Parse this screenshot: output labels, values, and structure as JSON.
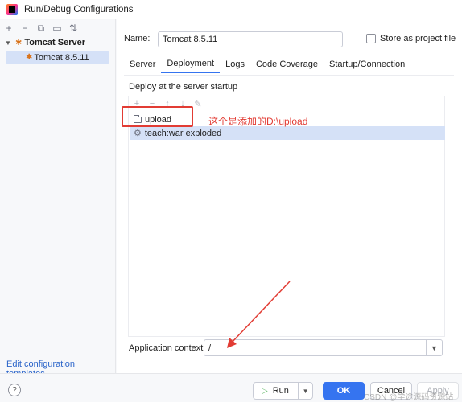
{
  "window": {
    "title": "Run/Debug Configurations"
  },
  "left_panel": {
    "toolbar_icons": [
      "add-icon",
      "remove-icon",
      "copy-icon",
      "folder-icon",
      "sort-icon"
    ],
    "group_label": "Tomcat Server",
    "selected_item": "Tomcat 8.5.11",
    "edit_templates_link": "Edit configuration templates..."
  },
  "config": {
    "name_label": "Name:",
    "name_value": "Tomcat 8.5.11",
    "store_label": "Store as project file",
    "store_checked": false
  },
  "tabs": [
    {
      "label": "Server",
      "active": false
    },
    {
      "label": "Deployment",
      "active": true
    },
    {
      "label": "Logs",
      "active": false
    },
    {
      "label": "Code Coverage",
      "active": false
    },
    {
      "label": "Startup/Connection",
      "active": false
    }
  ],
  "deployment": {
    "section_label": "Deploy at the server startup",
    "toolbar_icons": [
      "add-icon",
      "remove-icon",
      "move-up-icon",
      "move-down-icon",
      "edit-icon"
    ],
    "items": [
      {
        "label": "upload",
        "icon": "folder-icon"
      },
      {
        "label": "teach:war exploded",
        "icon": "artifact-icon",
        "selected": true
      }
    ],
    "annotation": "这个是添加的D:\\upload",
    "annotation_color": "#e23c34"
  },
  "app_context": {
    "label": "Application context:",
    "value": "/"
  },
  "buttons": {
    "help": "?",
    "run": "Run",
    "ok": "OK",
    "cancel": "Cancel",
    "apply": "Apply"
  },
  "watermark": "CSDN @学途源码资源站",
  "colors": {
    "accent": "#3574f0",
    "selection": "#d5e1f7",
    "annotation": "#e23c34"
  }
}
